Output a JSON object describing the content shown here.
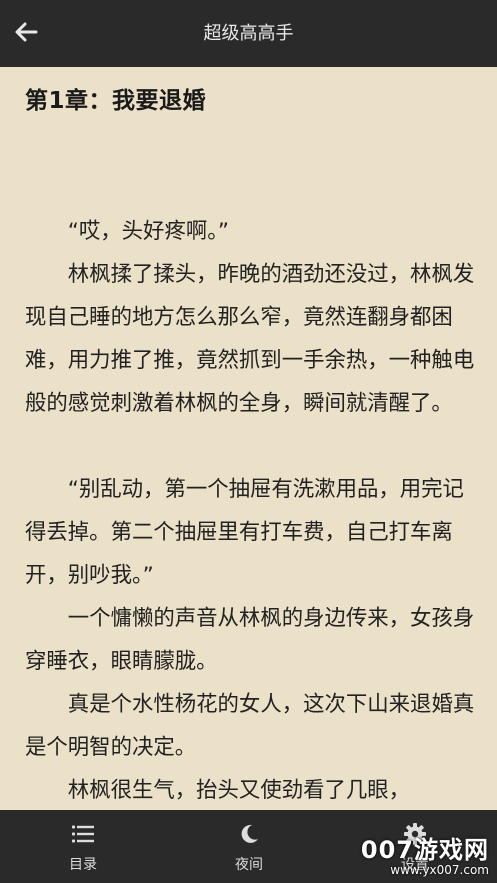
{
  "header": {
    "title": "超级高高手",
    "back_icon": "arrow-left-icon"
  },
  "chapter": {
    "title": "第1章：我要退婚",
    "paragraphs": [
      "“哎，头好疼啊。”",
      "林枫揉了揉头，昨晚的酒劲还没过，林枫发现自己睡的地方怎么那么窄，竟然连翻身都困难，用力推了推，竟然抓到一手余热，一种触电般的感觉刺激着林枫的全身，瞬间就清醒了。",
      "“别乱动，第一个抽屉有洗漱用品，用完记得丢掉。第二个抽屉里有打车费，自己打车离开，别吵我。”",
      "一个慵懒的声音从林枫的身边传来，女孩身穿睡衣，眼睛朦胧。",
      "真是个水性杨花的女人，这次下山来退婚真是个明智的决定。",
      "林枫很生气，抬头又使劲看了几眼，"
    ]
  },
  "bottom_nav": {
    "items": [
      {
        "label": "目录",
        "icon": "list-icon"
      },
      {
        "label": "夜间",
        "icon": "moon-icon"
      },
      {
        "label": "设置",
        "icon": "gear-icon"
      }
    ]
  },
  "watermark": {
    "text": "007游戏网",
    "url": "www.yx007.com"
  },
  "colors": {
    "background": "#ebe0c8",
    "bars": "#2a2a2a",
    "text": "#222222"
  }
}
